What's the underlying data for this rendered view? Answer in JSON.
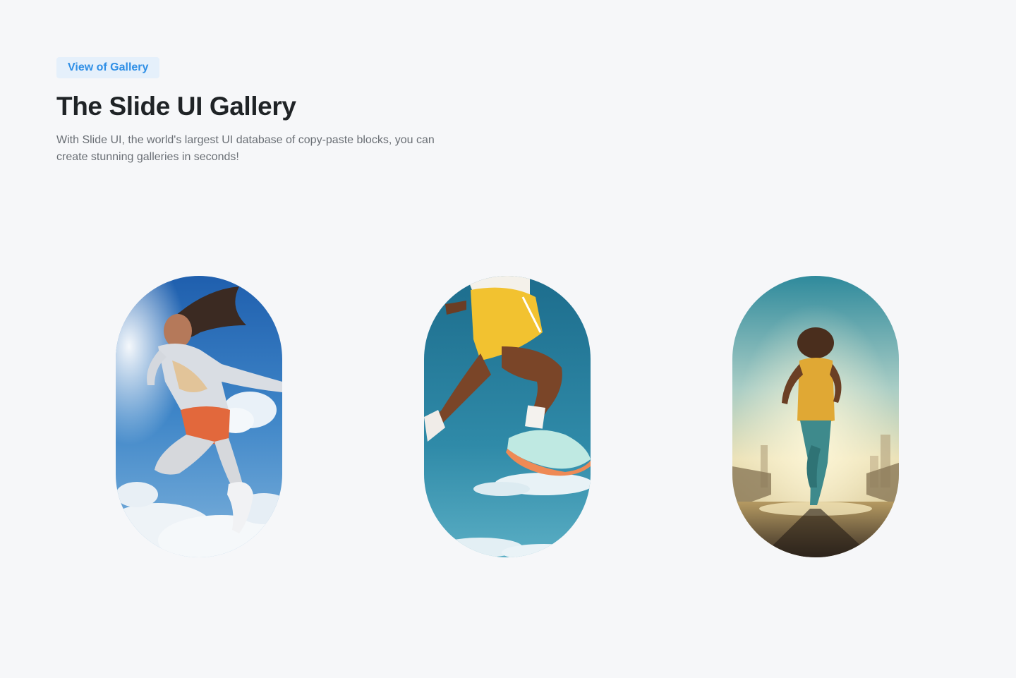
{
  "badge": "View of Gallery",
  "title": "The Slide UI Gallery",
  "description": "With Slide UI, the world's largest UI database of copy-paste blocks, you can create stunning galleries in seconds!",
  "gallery": {
    "images": [
      {
        "name": "jumping-woman-photo"
      },
      {
        "name": "runner-legs-photo"
      },
      {
        "name": "city-runner-photo"
      }
    ]
  },
  "colors": {
    "background": "#f6f7f9",
    "accent": "#2f8fe6",
    "badge_bg": "#e5f0fb",
    "title": "#1f2326",
    "body_text": "#6a6f75"
  }
}
